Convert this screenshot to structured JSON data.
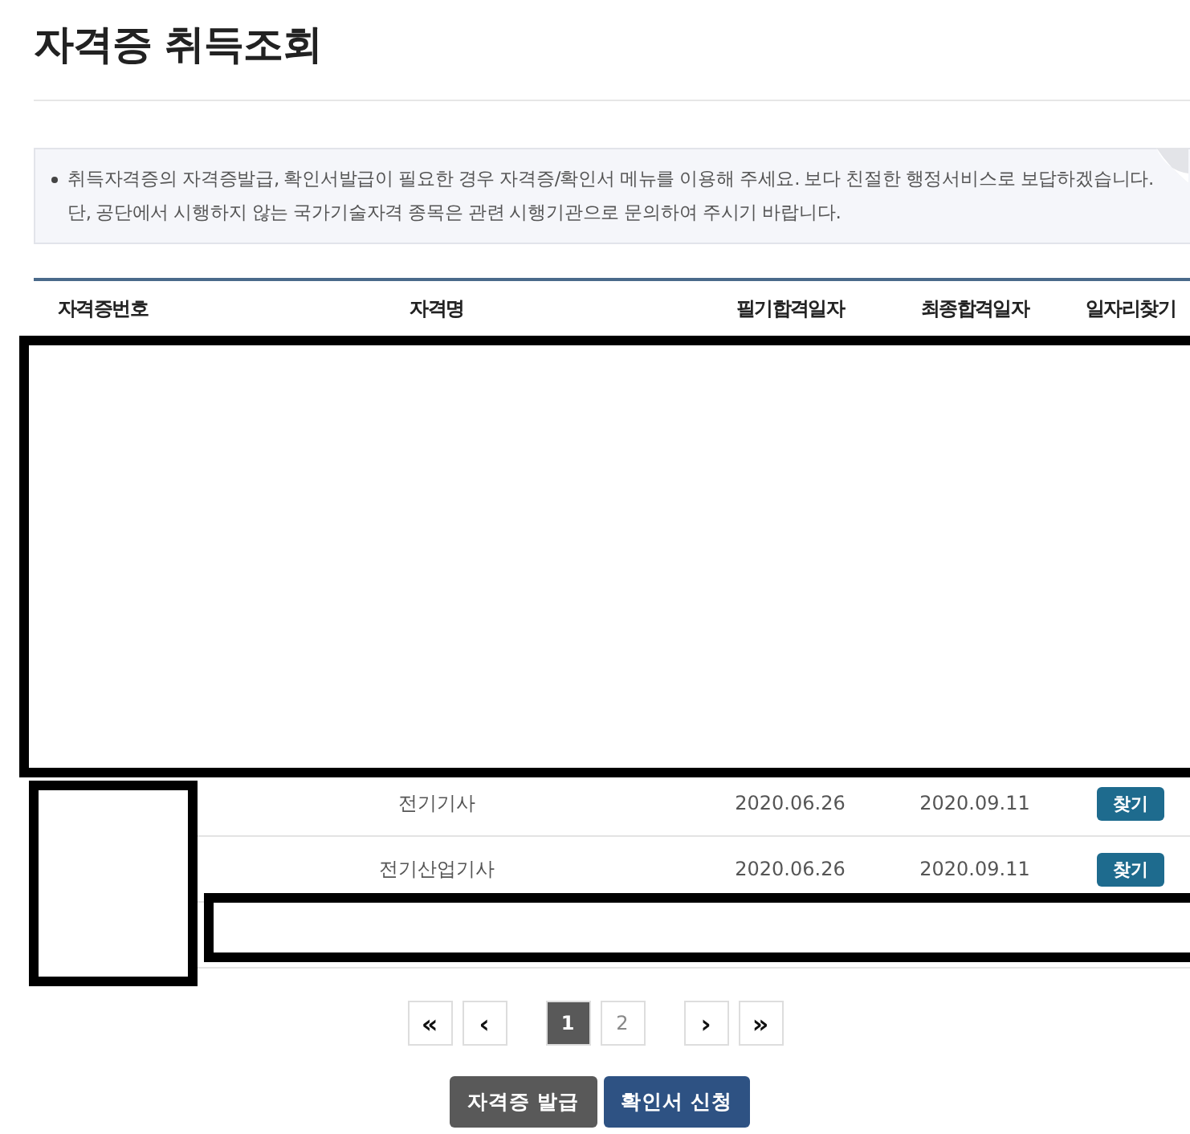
{
  "title": "자격증 취득조회",
  "notice": "취득자격증의 자격증발급, 확인서발급이 필요한 경우 자격증/확인서 메뉴를 이용해 주세요. 보다 친절한 행정서비스로 보답하겠습니다. 단, 공단에서 시행하지 않는 국가기술자격 종목은 관련 시행기관으로 문의하여 주시기 바랍니다.",
  "table": {
    "columns": [
      "자격증번호",
      "자격명",
      "필기합격일자",
      "최종합격일자",
      "일자리찾기"
    ],
    "rows": [
      {
        "name": "전기기사",
        "written_date": "2020.06.26",
        "final_date": "2020.09.11",
        "action": "찾기"
      },
      {
        "name": "전기산업기사",
        "written_date": "2020.06.26",
        "final_date": "2020.09.11",
        "action": "찾기"
      }
    ]
  },
  "pagination": {
    "first": "«",
    "prev": "‹",
    "pages": [
      {
        "label": "1",
        "selected": true
      },
      {
        "label": "2",
        "selected": false
      }
    ],
    "next": "›",
    "last": "»"
  },
  "buttons": [
    {
      "label": "자격증 발급",
      "kind": "secondary"
    },
    {
      "label": "확인서 신청",
      "kind": "primary"
    }
  ]
}
